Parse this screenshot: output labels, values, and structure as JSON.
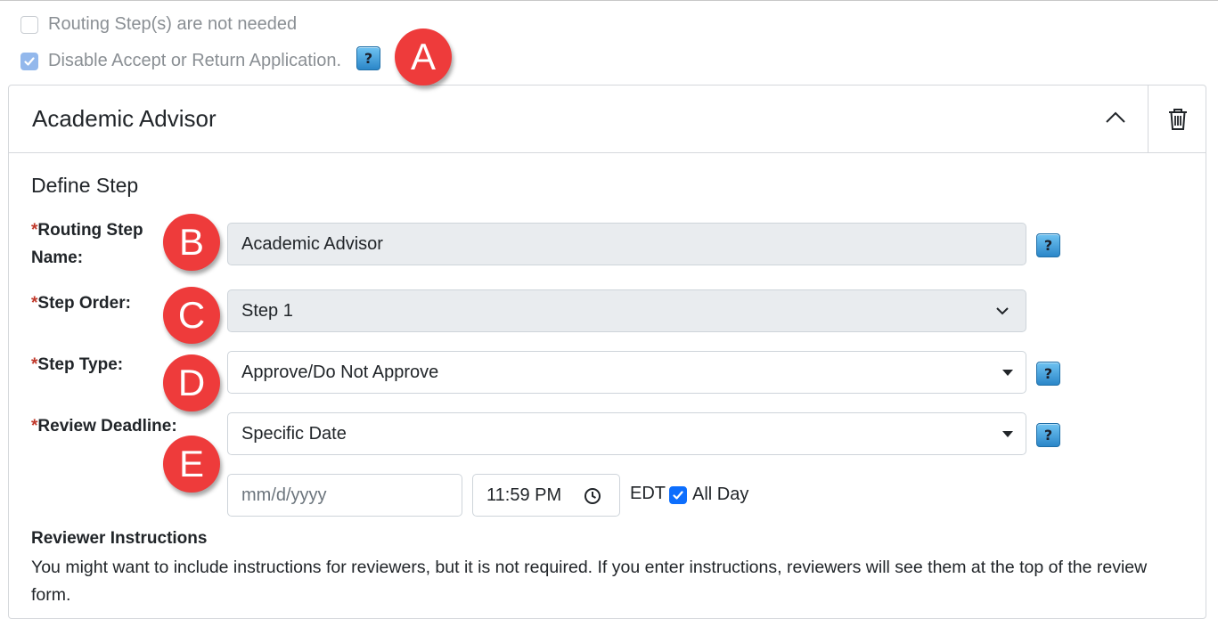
{
  "options": {
    "routing_not_needed": {
      "label": "Routing Step(s) are not needed",
      "checked": false
    },
    "disable_accept_return": {
      "label": "Disable Accept or Return Application.",
      "checked": true
    }
  },
  "annotations": [
    "A",
    "B",
    "C",
    "D",
    "E"
  ],
  "step_card": {
    "title": "Academic Advisor",
    "section_title": "Define Step",
    "routing_step_name": {
      "label_required": "*",
      "label": "Routing Step Name:",
      "value": "Academic Advisor"
    },
    "step_order": {
      "label_required": "*",
      "label": "Step Order:",
      "value": "Step 1"
    },
    "step_type": {
      "label_required": "*",
      "label": "Step Type:",
      "value": "Approve/Do Not Approve"
    },
    "review_deadline": {
      "label_required": "*",
      "label": "Review Deadline:",
      "value": "Specific Date",
      "date_placeholder": "mm/d/yyyy",
      "time_value": "11:59 PM",
      "timezone": "EDT",
      "all_day_label": "All Day",
      "all_day_checked": true
    },
    "reviewer_instructions": {
      "title": "Reviewer Instructions",
      "text": "You might want to include instructions for reviewers, but it is not required. If you enter instructions, reviewers will see them at the top of the review form."
    }
  },
  "help_icon_glyph": "?",
  "icons": [
    "help-icon",
    "chevron-up-icon",
    "trash-icon",
    "chevron-down-icon",
    "caret-down-icon",
    "clock-icon",
    "check-icon"
  ],
  "colors": {
    "badge": "#ee3b3b",
    "required": "#c0392b",
    "checkbox_checked": "#0d6efd",
    "disabled_field": "#e9ecef"
  }
}
